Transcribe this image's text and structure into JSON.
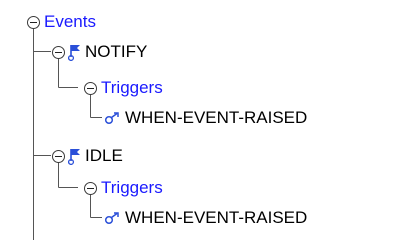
{
  "tree": {
    "root": {
      "label": "Events",
      "icon": "collapse-toggle-icon"
    },
    "events": [
      {
        "label": "NOTIFY",
        "icon": "event-flag-icon",
        "triggers_label": "Triggers",
        "trigger": {
          "label": "WHEN-EVENT-RAISED",
          "icon": "trigger-link-icon"
        }
      },
      {
        "label": "IDLE",
        "icon": "event-flag-icon",
        "triggers_label": "Triggers",
        "trigger": {
          "label": "WHEN-EVENT-RAISED",
          "icon": "trigger-link-icon"
        }
      }
    ]
  },
  "colors": {
    "node_link_blue": "#1a1aff",
    "text_black": "#000000",
    "connector_gray": "#555555",
    "flag_blue": "#2a4fd8"
  }
}
